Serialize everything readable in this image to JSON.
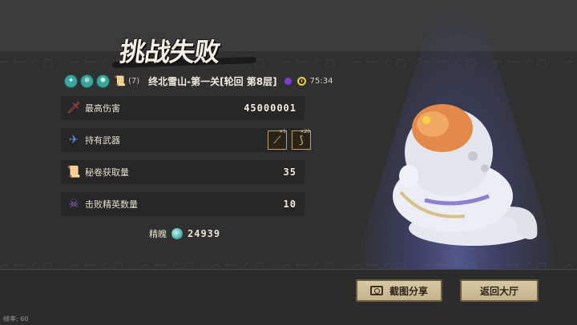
{
  "title": "挑战失败",
  "info": {
    "scroll_count": "(7)",
    "stage": "终北雪山-第一关[轮回 第8层]",
    "time": "75:34"
  },
  "stats": {
    "max_damage": {
      "label": "最高伤害",
      "value": "45000001"
    },
    "weapons": {
      "label": "持有武器",
      "items": [
        {
          "icon": "spear-icon",
          "level": "×5"
        },
        {
          "icon": "bow-icon",
          "level": "×20"
        }
      ]
    },
    "scrolls": {
      "label": "秘卷获取量",
      "value": "35"
    },
    "elites": {
      "label": "击败精英数量",
      "value": "10"
    }
  },
  "soul": {
    "label": "精魄",
    "value": "24939"
  },
  "buttons": {
    "share": "截图分享",
    "lobby": "返回大厅"
  },
  "fps": "帧率: 60",
  "colors": {
    "accent_teal": "#3aa59c",
    "button_bg": "#d8c9a6",
    "spotlight": "#5a64c8"
  }
}
